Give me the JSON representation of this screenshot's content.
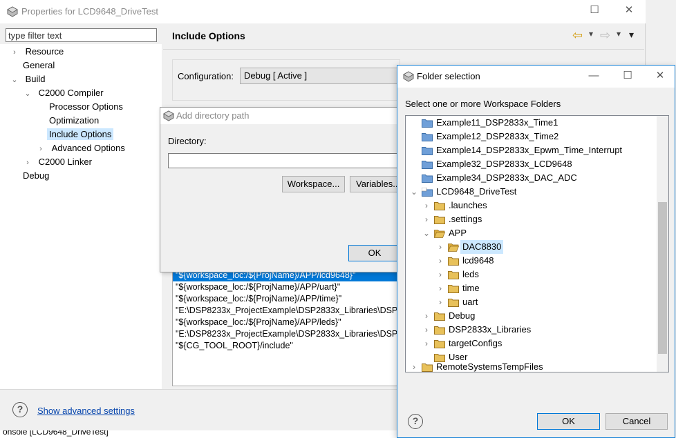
{
  "properties_window": {
    "title": "Properties for LCD9648_DriveTest",
    "filter_placeholder": "type filter text",
    "tree": [
      {
        "label": "Resource",
        "expander": "›"
      },
      {
        "label": "General",
        "expander": ""
      },
      {
        "label": "Build",
        "expander": "⌄"
      },
      {
        "label": "C2000 Compiler",
        "expander": "⌄"
      },
      {
        "label": "Processor Options",
        "expander": ""
      },
      {
        "label": "Optimization",
        "expander": ""
      },
      {
        "label": "Include Options",
        "expander": "",
        "selected": true
      },
      {
        "label": "Advanced Options",
        "expander": "›"
      },
      {
        "label": "C2000 Linker",
        "expander": "›"
      },
      {
        "label": "Debug",
        "expander": ""
      }
    ],
    "page_title": "Include Options",
    "configuration_label": "Configuration:",
    "configuration_value": "Debug  [ Active ]",
    "include_paths": [
      {
        "text": "\"${workspace_loc:/${ProjName}/APP/lcd9648}\"",
        "selected": true
      },
      {
        "text": "\"${workspace_loc:/${ProjName}/APP/uart}\""
      },
      {
        "text": "\"${workspace_loc:/${ProjName}/APP/time}\""
      },
      {
        "text": "\"E:\\DSP8233x_ProjectExample\\DSP2833x_Libraries\\DSP2"
      },
      {
        "text": "\"${workspace_loc:/${ProjName}/APP/leds}\""
      },
      {
        "text": "\"E:\\DSP8233x_ProjectExample\\DSP2833x_Libraries\\DSP2"
      },
      {
        "text": "\"${CG_TOOL_ROOT}/include\""
      }
    ],
    "advanced_link": "Show advanced settings",
    "console_text": "onsole [LCD9648_DriveTest]"
  },
  "add_directory_dialog": {
    "title": "Add directory path",
    "directory_label": "Directory:",
    "directory_value": "",
    "workspace_button": "Workspace...",
    "variables_button": "Variables...",
    "ok_button": "OK"
  },
  "folder_dialog": {
    "title": "Folder selection",
    "instruction": "Select one or more Workspace Folders",
    "items": [
      {
        "label": "Example11_DSP2833x_Time1",
        "depth": 0,
        "expander": "",
        "icon": "project-folder-icon"
      },
      {
        "label": "Example12_DSP2833x_Time2",
        "depth": 0,
        "expander": "",
        "icon": "project-folder-icon"
      },
      {
        "label": "Example14_DSP2833x_Epwm_Time_Interrupt",
        "depth": 0,
        "expander": "",
        "icon": "project-folder-icon"
      },
      {
        "label": "Example32_DSP2833x_LCD9648",
        "depth": 0,
        "expander": "",
        "icon": "project-folder-icon"
      },
      {
        "label": "Example34_DSP2833x_DAC_ADC",
        "depth": 0,
        "expander": "",
        "icon": "project-folder-icon"
      },
      {
        "label": "LCD9648_DriveTest",
        "depth": 0,
        "expander": "⌄",
        "icon": "ccs-project-icon"
      },
      {
        "label": ".launches",
        "depth": 1,
        "expander": "›",
        "icon": "folder-icon"
      },
      {
        "label": ".settings",
        "depth": 1,
        "expander": "›",
        "icon": "folder-icon"
      },
      {
        "label": "APP",
        "depth": 1,
        "expander": "⌄",
        "icon": "folder-open-icon"
      },
      {
        "label": "DAC8830",
        "depth": 2,
        "expander": "›",
        "icon": "folder-open-icon",
        "selected": true
      },
      {
        "label": "lcd9648",
        "depth": 2,
        "expander": "›",
        "icon": "folder-icon"
      },
      {
        "label": "leds",
        "depth": 2,
        "expander": "›",
        "icon": "folder-icon"
      },
      {
        "label": "time",
        "depth": 2,
        "expander": "›",
        "icon": "folder-icon"
      },
      {
        "label": "uart",
        "depth": 2,
        "expander": "›",
        "icon": "folder-icon"
      },
      {
        "label": "Debug",
        "depth": 1,
        "expander": "›",
        "icon": "folder-icon"
      },
      {
        "label": "DSP2833x_Libraries",
        "depth": 1,
        "expander": "›",
        "icon": "folder-icon"
      },
      {
        "label": "targetConfigs",
        "depth": 1,
        "expander": "›",
        "icon": "folder-icon"
      },
      {
        "label": "User",
        "depth": 1,
        "expander": "",
        "icon": "folder-icon"
      },
      {
        "label": "RemoteSystemsTempFiles",
        "depth": 0,
        "expander": "›",
        "icon": "folder-icon",
        "cut_off": true
      }
    ],
    "ok_button": "OK",
    "cancel_button": "Cancel"
  },
  "icons": {
    "help": "?",
    "minimize": "—",
    "maximize": "☐",
    "close": "✕",
    "back_arrow": "⇦",
    "forward_arrow": "⇨",
    "dropdown": "▾"
  },
  "colors": {
    "selection_blue": "#0078d7",
    "tree_selection": "#cce8ff",
    "folder_yellow": "#e8c15a",
    "project_folder_blue": "#6f9fd8",
    "link_blue": "#0645ad"
  }
}
